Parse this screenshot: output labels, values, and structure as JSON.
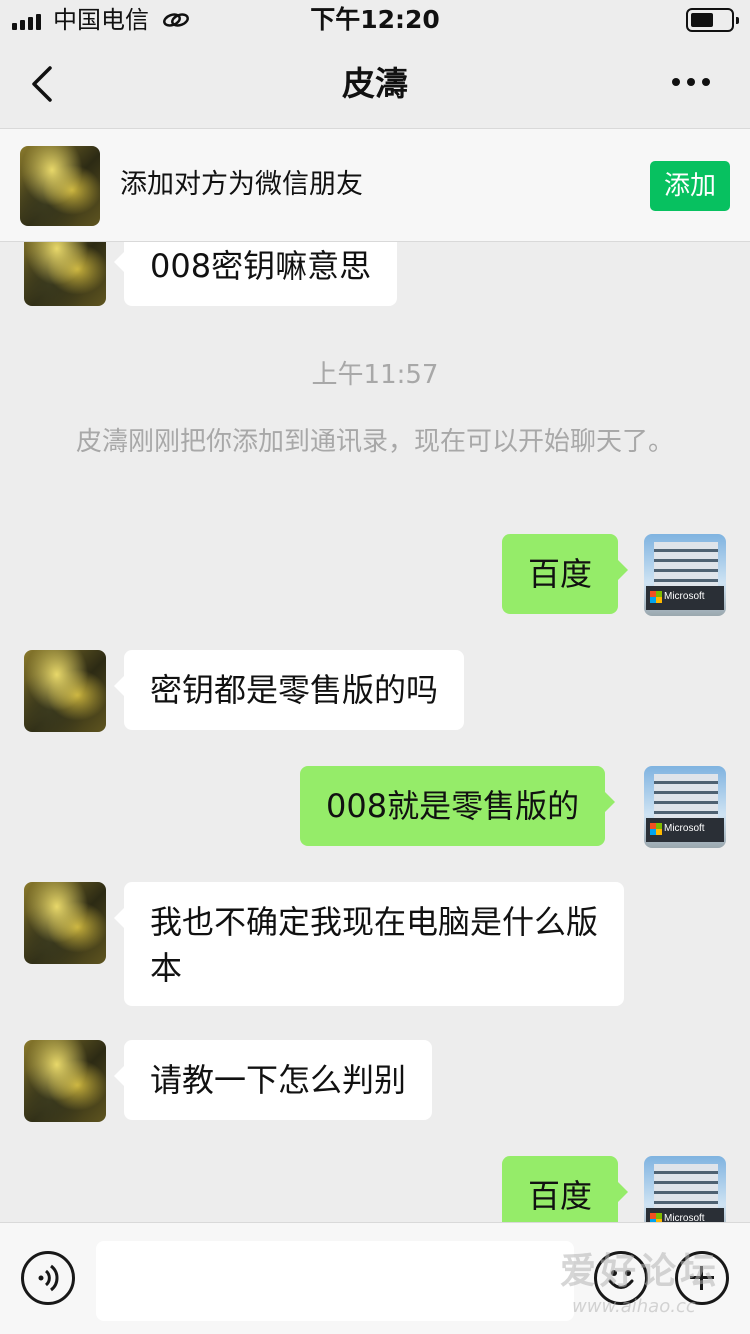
{
  "status_bar": {
    "carrier": "中国电信",
    "time": "下午12:20",
    "icons": [
      "signal-icon",
      "link-icon",
      "battery-icon"
    ]
  },
  "nav": {
    "title": "皮濤",
    "icons": [
      "back-chevron-icon",
      "more-dots-icon"
    ]
  },
  "banner": {
    "text": "添加对方为微信朋友",
    "button": "添加"
  },
  "messages": [
    {
      "side": "left",
      "text": "008密钥嘛意思"
    },
    {
      "type": "time",
      "text": "上午11:57"
    },
    {
      "type": "system",
      "text": "皮濤刚刚把你添加到通讯录，现在可以开始聊天了。"
    },
    {
      "side": "right",
      "text": "百度"
    },
    {
      "side": "left",
      "text": "密钥都是零售版的吗"
    },
    {
      "side": "right",
      "text": "008就是零售版的"
    },
    {
      "side": "left",
      "text": "我也不确定我现在电脑是什么版本"
    },
    {
      "side": "left",
      "text": "请教一下怎么判别"
    },
    {
      "side": "right",
      "text": "百度"
    }
  ],
  "self_avatar_sign": "Microsoft",
  "input_bar": {
    "icons": [
      "voice-icon",
      "emoji-icon",
      "plus-icon"
    ]
  },
  "watermark": {
    "main": "爱好论坛",
    "sub": "www.aihao.cc"
  },
  "colors": {
    "background": "#ededed",
    "right_bubble": "#95ec69",
    "left_bubble": "#ffffff",
    "accent_button": "#07c160",
    "meta_text": "#a8a8a8"
  }
}
